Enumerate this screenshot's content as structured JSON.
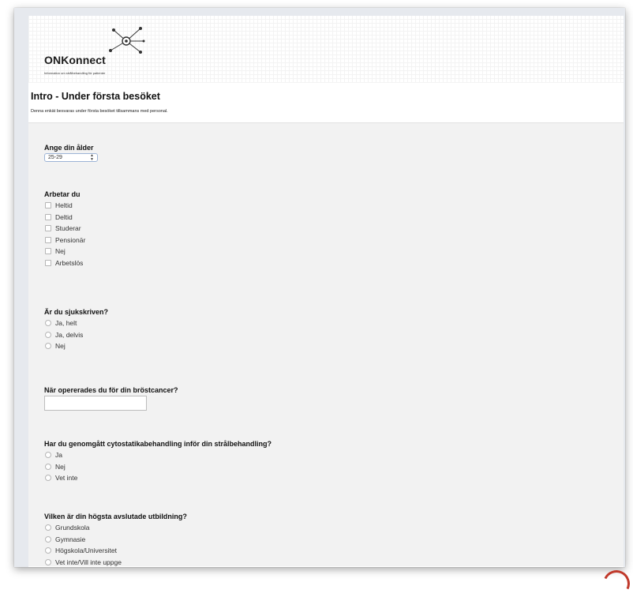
{
  "header": {
    "logo_text": "ONKonnect",
    "logo_tagline": "Information om strålbehandling för patienter"
  },
  "form": {
    "title": "Intro - Under första besöket",
    "description": "Denna enkät besvaras under första besöket tillsammans med personal."
  },
  "questions": {
    "age": {
      "label": "Ange din ålder",
      "selected": "25-29"
    },
    "work": {
      "label": "Arbetar du",
      "options": [
        "Heltid",
        "Deltid",
        "Studerar",
        "Pensionär",
        "Nej",
        "Arbetslös"
      ]
    },
    "sick": {
      "label": "Är du sjukskriven?",
      "options": [
        "Ja, helt",
        "Ja, delvis",
        "Nej"
      ]
    },
    "surgery": {
      "label": "När opererades du för din bröstcancer?",
      "value": ""
    },
    "chemo": {
      "label": "Har du genomgått cytostatikabehandling inför din strålbehandling?",
      "options": [
        "Ja",
        "Nej",
        "Vet inte"
      ]
    },
    "education": {
      "label": "Vilken är din högsta avslutade utbildning?",
      "options": [
        "Grundskola",
        "Gymnasie",
        "Högskola/Universitet",
        "Vet inte/Vill inte uppge"
      ]
    }
  },
  "icons": {
    "logo": "molecule-network-icon",
    "select_arrow": "updown-arrow-icon"
  },
  "colors": {
    "select_border": "#9db4d6",
    "corner_mark": "#c0392b"
  }
}
